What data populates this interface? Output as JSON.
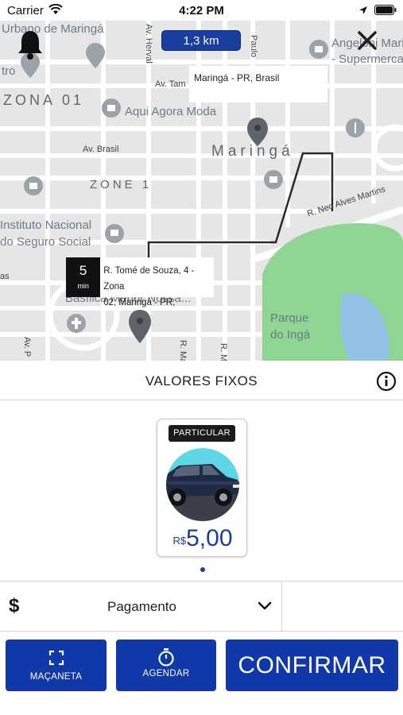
{
  "status_bar": {
    "carrier": "Carrier",
    "time": "4:22 PM"
  },
  "map": {
    "distance": "1,3 km",
    "destination_address": "Maringá - PR, Brasil",
    "origin": {
      "eta_value": "5",
      "eta_unit": "min",
      "address_line1": "R. Tomé de Souza, 4 - Zona",
      "address_line2": "02, Maringá - PR,"
    },
    "labels": {
      "urbano": "Urbano de Maringá",
      "tro": "tro",
      "zona01": "ZONA 01",
      "aqui_agora": "Aqui Agora Moda",
      "angeloni": "Angeloni Maringá",
      "supermercado": "- Supermercado",
      "av_tamandare": "Av. Tam",
      "av_herval": "Av. Herval",
      "paulo": "Paulo",
      "av_brasil": "Av. Brasil",
      "maringa": "Maringá",
      "zone1": "ZONE 1",
      "instituto1": "Instituto Nacional",
      "instituto2": "do Seguro Social",
      "neo_alves": "R. Neo Alves Martins",
      "as": "as",
      "basilica": "Basílica Menor Nossa...",
      "parque1": "Parque",
      "parque2": "do Ingá",
      "av_p": "Av. P",
      "r_ma": "R. Ma",
      "r_m": "R. M"
    }
  },
  "fixed_values": {
    "title": "VALORES FIXOS"
  },
  "category": {
    "badge": "PARTICULAR",
    "currency": "R$",
    "price": "5,00"
  },
  "payment": {
    "icon_glyph": "$",
    "label": "Pagamento"
  },
  "buttons": {
    "macaneta": "MAÇANETA",
    "agendar": "AGENDAR",
    "confirmar": "CONFIRMAR"
  },
  "colors": {
    "accent": "#1038a8",
    "map_background": "#e6e6e6",
    "park": "#8fd694",
    "water": "#93c2e6",
    "route": "#2a2a2a"
  },
  "icons": {
    "bell": "bell-icon",
    "close": "close-icon",
    "info": "info-icon",
    "dollar": "dollar-icon",
    "chevron": "chevron-down-icon",
    "expand": "expand-icon",
    "timer": "stopwatch-icon"
  }
}
